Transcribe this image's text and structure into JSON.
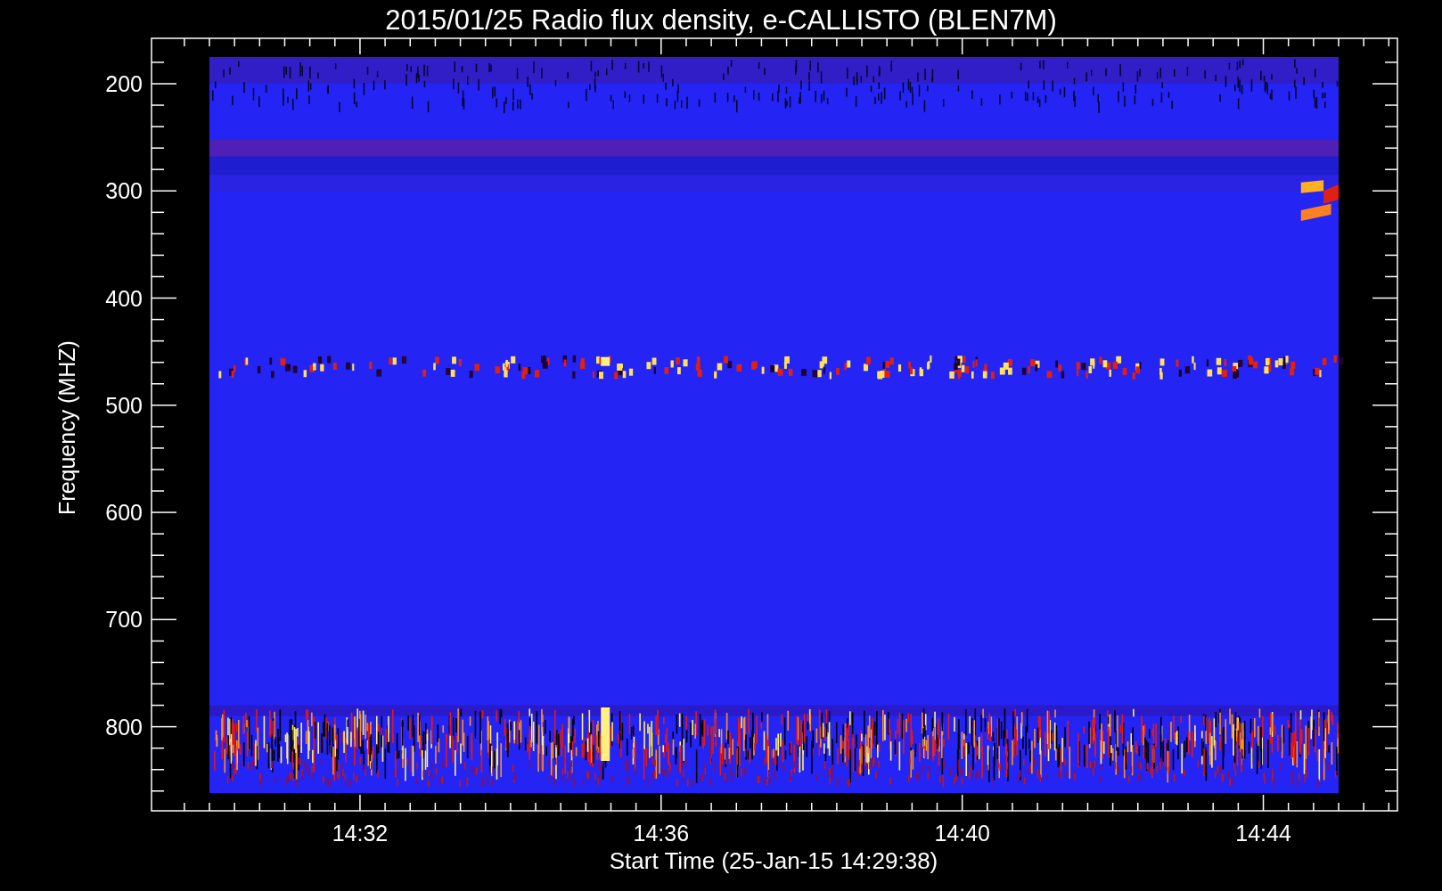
{
  "title": "2015/01/25  Radio flux density, e-CALLISTO (BLEN7M)",
  "y_axis": {
    "label": "Frequency (MHZ)",
    "ticks": [
      "200",
      "300",
      "400",
      "500",
      "600",
      "700",
      "800"
    ]
  },
  "x_axis": {
    "label": "Start Time (25-Jan-15 14:29:38)",
    "ticks": [
      "14:32",
      "14:36",
      "14:40",
      "14:44"
    ]
  }
}
